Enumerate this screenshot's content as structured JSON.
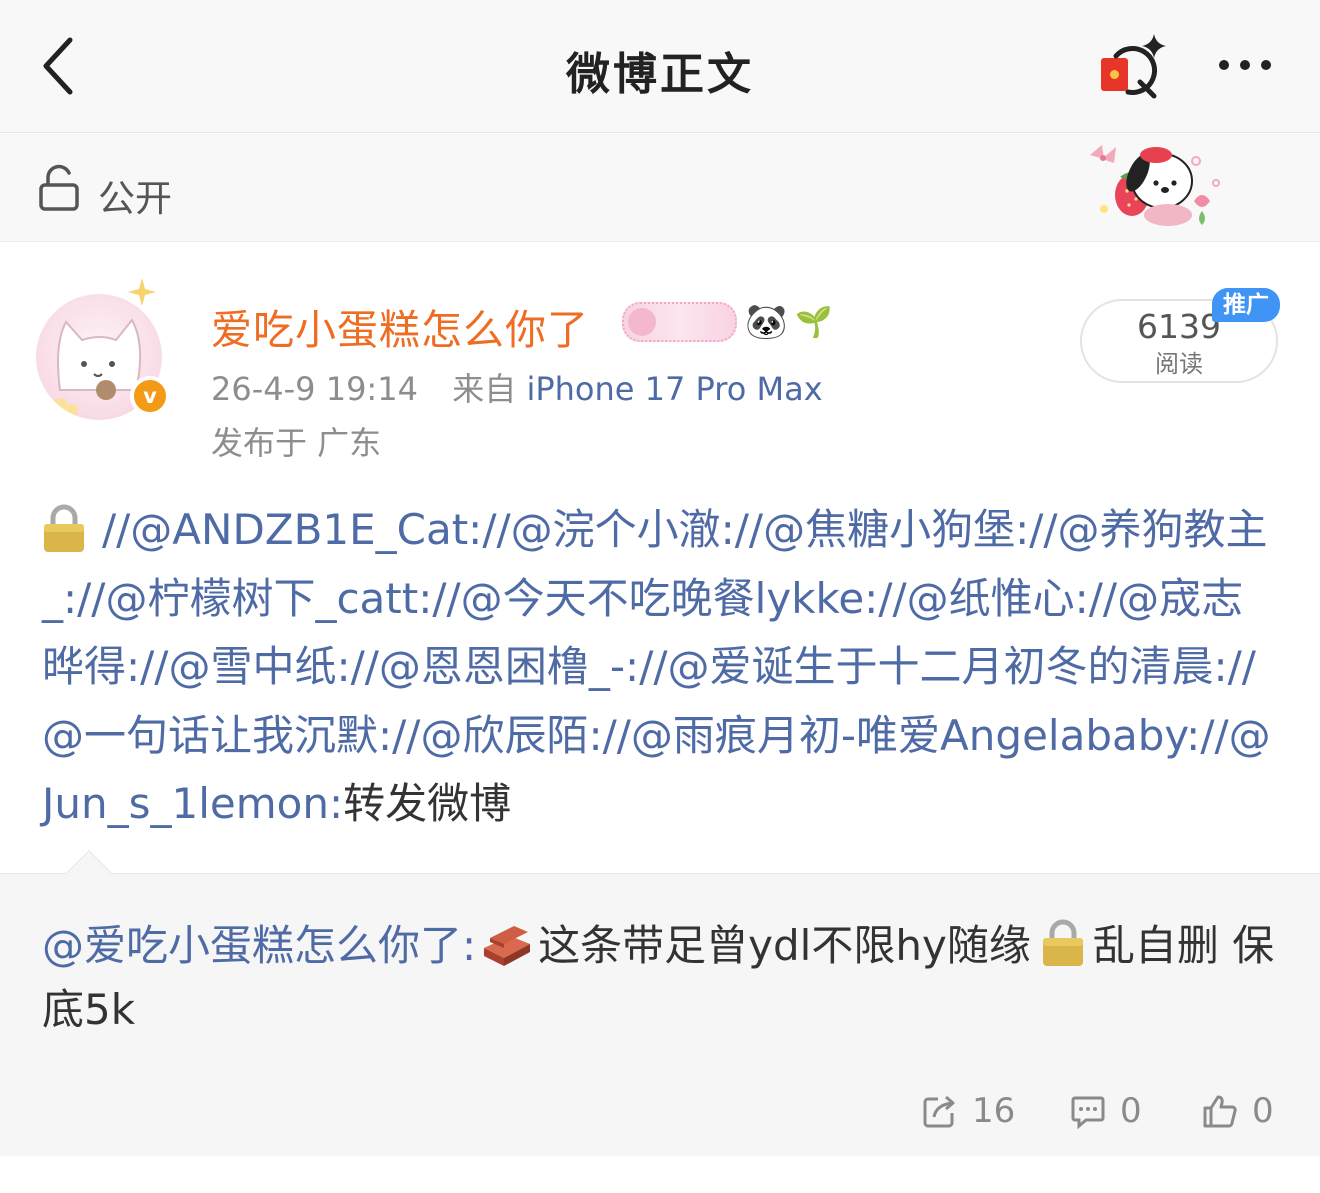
{
  "header": {
    "title": "微博正文",
    "back_icon": "chevron-left-icon",
    "search_icon": "ai-search-icon",
    "more_icon": "more-dots-icon"
  },
  "visibility": {
    "label": "公开",
    "icon": "lock-open-icon"
  },
  "post": {
    "username": "爱吃小蛋糕怎么你了",
    "name_emojis": [
      "🐼",
      "🌱"
    ],
    "datetime": "26-4-9 19:14",
    "source_prefix": "来自",
    "source": "iPhone 17 Pro Max",
    "location": "发布于 广东",
    "reads": {
      "count": "6139",
      "label": "阅读",
      "promo": "推广"
    },
    "repost_chain": "//@ANDZB1E_Cat://@浣个小澈://@焦糖小狗堡://@养狗教主_://@柠檬树下_catt://@今天不吃晚餐lykke://@纸惟心://@宬志晔得://@雪中纸://@恩恩困橹_-://@爱诞生于十二月初冬的清晨://@一句话让我沉默://@欣辰陌://@雨痕月初-唯爱Angelababy://@Jun_s_1lemon:",
    "repost_tail": "转发微博"
  },
  "original": {
    "mention": "@爱吃小蛋糕怎么你了:",
    "text_part1": "这条带足曾ydl不限hy随缘",
    "text_part2": "乱自删 保底5k"
  },
  "actions": {
    "reposts": "16",
    "comments": "0",
    "likes": "0"
  },
  "colors": {
    "link": "#4f6ba6",
    "username": "#ee6d22",
    "verified": "#f39a17",
    "promo": "#3f94f5"
  }
}
